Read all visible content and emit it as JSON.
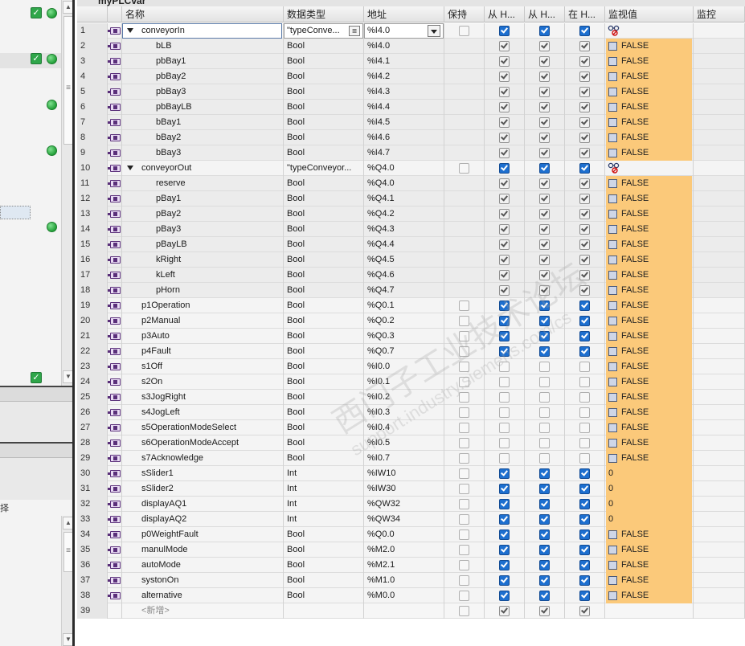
{
  "window": {
    "title_partial": "myPLCvar"
  },
  "table": {
    "headers": {
      "name": "名称",
      "type": "数据类型",
      "address": "地址",
      "retain": "保持",
      "from_hmi1": "从 H...",
      "from_hmi2": "从 H...",
      "in_hmi": "在 H...",
      "monitor_value": "监视值",
      "monitor": "监控"
    },
    "rows": [
      {
        "n": "1",
        "name": "conveyorIn",
        "type": "\"typeConve...",
        "addr": "%I4.0",
        "level": 0,
        "expand": true,
        "retain": "empty",
        "h1": "blue",
        "h2": "blue",
        "h3": "blue",
        "mon": "glasses",
        "editing": true
      },
      {
        "n": "2",
        "name": "bLB",
        "type": "Bool",
        "addr": "%I4.0",
        "level": 1,
        "retain": "none",
        "h1": "grey",
        "h2": "grey",
        "h3": "grey",
        "mon": "FALSE"
      },
      {
        "n": "3",
        "name": "pbBay1",
        "type": "Bool",
        "addr": "%I4.1",
        "level": 1,
        "retain": "none",
        "h1": "grey",
        "h2": "grey",
        "h3": "grey",
        "mon": "FALSE"
      },
      {
        "n": "4",
        "name": "pbBay2",
        "type": "Bool",
        "addr": "%I4.2",
        "level": 1,
        "retain": "none",
        "h1": "grey",
        "h2": "grey",
        "h3": "grey",
        "mon": "FALSE"
      },
      {
        "n": "5",
        "name": "pbBay3",
        "type": "Bool",
        "addr": "%I4.3",
        "level": 1,
        "retain": "none",
        "h1": "grey",
        "h2": "grey",
        "h3": "grey",
        "mon": "FALSE"
      },
      {
        "n": "6",
        "name": "pbBayLB",
        "type": "Bool",
        "addr": "%I4.4",
        "level": 1,
        "retain": "none",
        "h1": "grey",
        "h2": "grey",
        "h3": "grey",
        "mon": "FALSE"
      },
      {
        "n": "7",
        "name": "bBay1",
        "type": "Bool",
        "addr": "%I4.5",
        "level": 1,
        "retain": "none",
        "h1": "grey",
        "h2": "grey",
        "h3": "grey",
        "mon": "FALSE"
      },
      {
        "n": "8",
        "name": "bBay2",
        "type": "Bool",
        "addr": "%I4.6",
        "level": 1,
        "retain": "none",
        "h1": "grey",
        "h2": "grey",
        "h3": "grey",
        "mon": "FALSE"
      },
      {
        "n": "9",
        "name": "bBay3",
        "type": "Bool",
        "addr": "%I4.7",
        "level": 1,
        "retain": "none",
        "h1": "grey",
        "h2": "grey",
        "h3": "grey",
        "mon": "FALSE"
      },
      {
        "n": "10",
        "name": "conveyorOut",
        "type": "\"typeConveyor...",
        "addr": "%Q4.0",
        "level": 0,
        "expand": true,
        "retain": "empty",
        "h1": "blue",
        "h2": "blue",
        "h3": "blue",
        "mon": "glasses"
      },
      {
        "n": "11",
        "name": "reserve",
        "type": "Bool",
        "addr": "%Q4.0",
        "level": 1,
        "retain": "none",
        "h1": "grey",
        "h2": "grey",
        "h3": "grey",
        "mon": "FALSE"
      },
      {
        "n": "12",
        "name": "pBay1",
        "type": "Bool",
        "addr": "%Q4.1",
        "level": 1,
        "retain": "none",
        "h1": "grey",
        "h2": "grey",
        "h3": "grey",
        "mon": "FALSE"
      },
      {
        "n": "13",
        "name": "pBay2",
        "type": "Bool",
        "addr": "%Q4.2",
        "level": 1,
        "retain": "none",
        "h1": "grey",
        "h2": "grey",
        "h3": "grey",
        "mon": "FALSE"
      },
      {
        "n": "14",
        "name": "pBay3",
        "type": "Bool",
        "addr": "%Q4.3",
        "level": 1,
        "retain": "none",
        "h1": "grey",
        "h2": "grey",
        "h3": "grey",
        "mon": "FALSE"
      },
      {
        "n": "15",
        "name": "pBayLB",
        "type": "Bool",
        "addr": "%Q4.4",
        "level": 1,
        "retain": "none",
        "h1": "grey",
        "h2": "grey",
        "h3": "grey",
        "mon": "FALSE"
      },
      {
        "n": "16",
        "name": "kRight",
        "type": "Bool",
        "addr": "%Q4.5",
        "level": 1,
        "retain": "none",
        "h1": "grey",
        "h2": "grey",
        "h3": "grey",
        "mon": "FALSE"
      },
      {
        "n": "17",
        "name": "kLeft",
        "type": "Bool",
        "addr": "%Q4.6",
        "level": 1,
        "retain": "none",
        "h1": "grey",
        "h2": "grey",
        "h3": "grey",
        "mon": "FALSE"
      },
      {
        "n": "18",
        "name": "pHorn",
        "type": "Bool",
        "addr": "%Q4.7",
        "level": 1,
        "retain": "none",
        "h1": "grey",
        "h2": "grey",
        "h3": "grey",
        "mon": "FALSE"
      },
      {
        "n": "19",
        "name": "p1Operation",
        "type": "Bool",
        "addr": "%Q0.1",
        "level": 0,
        "retain": "empty",
        "h1": "blue",
        "h2": "blue",
        "h3": "blue",
        "mon": "FALSE"
      },
      {
        "n": "20",
        "name": "p2Manual",
        "type": "Bool",
        "addr": "%Q0.2",
        "level": 0,
        "retain": "empty",
        "h1": "blue",
        "h2": "blue",
        "h3": "blue",
        "mon": "FALSE"
      },
      {
        "n": "21",
        "name": "p3Auto",
        "type": "Bool",
        "addr": "%Q0.3",
        "level": 0,
        "retain": "empty",
        "h1": "blue",
        "h2": "blue",
        "h3": "blue",
        "mon": "FALSE"
      },
      {
        "n": "22",
        "name": "p4Fault",
        "type": "Bool",
        "addr": "%Q0.7",
        "level": 0,
        "retain": "empty",
        "h1": "blue",
        "h2": "blue",
        "h3": "blue",
        "mon": "FALSE"
      },
      {
        "n": "23",
        "name": "s1Off",
        "type": "Bool",
        "addr": "%I0.0",
        "level": 0,
        "retain": "empty",
        "h1": "empty",
        "h2": "empty",
        "h3": "empty",
        "mon": "FALSE"
      },
      {
        "n": "24",
        "name": "s2On",
        "type": "Bool",
        "addr": "%I0.1",
        "level": 0,
        "retain": "empty",
        "h1": "empty",
        "h2": "empty",
        "h3": "empty",
        "mon": "FALSE"
      },
      {
        "n": "25",
        "name": "s3JogRight",
        "type": "Bool",
        "addr": "%I0.2",
        "level": 0,
        "retain": "empty",
        "h1": "empty",
        "h2": "empty",
        "h3": "empty",
        "mon": "FALSE"
      },
      {
        "n": "26",
        "name": "s4JogLeft",
        "type": "Bool",
        "addr": "%I0.3",
        "level": 0,
        "retain": "empty",
        "h1": "empty",
        "h2": "empty",
        "h3": "empty",
        "mon": "FALSE"
      },
      {
        "n": "27",
        "name": "s5OperationModeSelect",
        "type": "Bool",
        "addr": "%I0.4",
        "level": 0,
        "retain": "empty",
        "h1": "empty",
        "h2": "empty",
        "h3": "empty",
        "mon": "FALSE"
      },
      {
        "n": "28",
        "name": "s6OperationModeAccept",
        "type": "Bool",
        "addr": "%I0.5",
        "level": 0,
        "retain": "empty",
        "h1": "empty",
        "h2": "empty",
        "h3": "empty",
        "mon": "FALSE"
      },
      {
        "n": "29",
        "name": "s7Acknowledge",
        "type": "Bool",
        "addr": "%I0.7",
        "level": 0,
        "retain": "empty",
        "h1": "empty",
        "h2": "empty",
        "h3": "empty",
        "mon": "FALSE"
      },
      {
        "n": "30",
        "name": "sSlider1",
        "type": "Int",
        "addr": "%IW10",
        "level": 0,
        "retain": "empty",
        "h1": "blue",
        "h2": "blue",
        "h3": "blue",
        "mon": "0"
      },
      {
        "n": "31",
        "name": "sSlider2",
        "type": "Int",
        "addr": "%IW30",
        "level": 0,
        "retain": "empty",
        "h1": "blue",
        "h2": "blue",
        "h3": "blue",
        "mon": "0"
      },
      {
        "n": "32",
        "name": "displayAQ1",
        "type": "Int",
        "addr": "%QW32",
        "level": 0,
        "retain": "empty",
        "h1": "blue",
        "h2": "blue",
        "h3": "blue",
        "mon": "0"
      },
      {
        "n": "33",
        "name": "displayAQ2",
        "type": "Int",
        "addr": "%QW34",
        "level": 0,
        "retain": "empty",
        "h1": "blue",
        "h2": "blue",
        "h3": "blue",
        "mon": "0"
      },
      {
        "n": "34",
        "name": "p0WeightFault",
        "type": "Bool",
        "addr": "%Q0.0",
        "level": 0,
        "retain": "empty",
        "h1": "blue",
        "h2": "blue",
        "h3": "blue",
        "mon": "FALSE"
      },
      {
        "n": "35",
        "name": "manulMode",
        "type": "Bool",
        "addr": "%M2.0",
        "level": 0,
        "retain": "empty",
        "h1": "blue",
        "h2": "blue",
        "h3": "blue",
        "mon": "FALSE"
      },
      {
        "n": "36",
        "name": "autoMode",
        "type": "Bool",
        "addr": "%M2.1",
        "level": 0,
        "retain": "empty",
        "h1": "blue",
        "h2": "blue",
        "h3": "blue",
        "mon": "FALSE"
      },
      {
        "n": "37",
        "name": "systonOn",
        "type": "Bool",
        "addr": "%M1.0",
        "level": 0,
        "retain": "empty",
        "h1": "blue",
        "h2": "blue",
        "h3": "blue",
        "mon": "FALSE"
      },
      {
        "n": "38",
        "name": "alternative",
        "type": "Bool",
        "addr": "%M0.0",
        "level": 0,
        "retain": "empty",
        "h1": "blue",
        "h2": "blue",
        "h3": "blue",
        "mon": "FALSE"
      },
      {
        "n": "39",
        "name": "<新增>",
        "type": "",
        "addr": "",
        "level": 0,
        "placeholder": true,
        "retain": "empty",
        "h1": "grey",
        "h2": "grey",
        "h3": "grey",
        "mon": "none"
      }
    ]
  },
  "left_pane": {
    "partial_label": "择"
  },
  "watermark": {
    "line1": "西门子工业技术论坛",
    "line2": "support.industry.siemens.com/cs"
  },
  "colors": {
    "monitor_bg": "#fbc97a",
    "checkbox_blue": "#1d6fcf"
  }
}
